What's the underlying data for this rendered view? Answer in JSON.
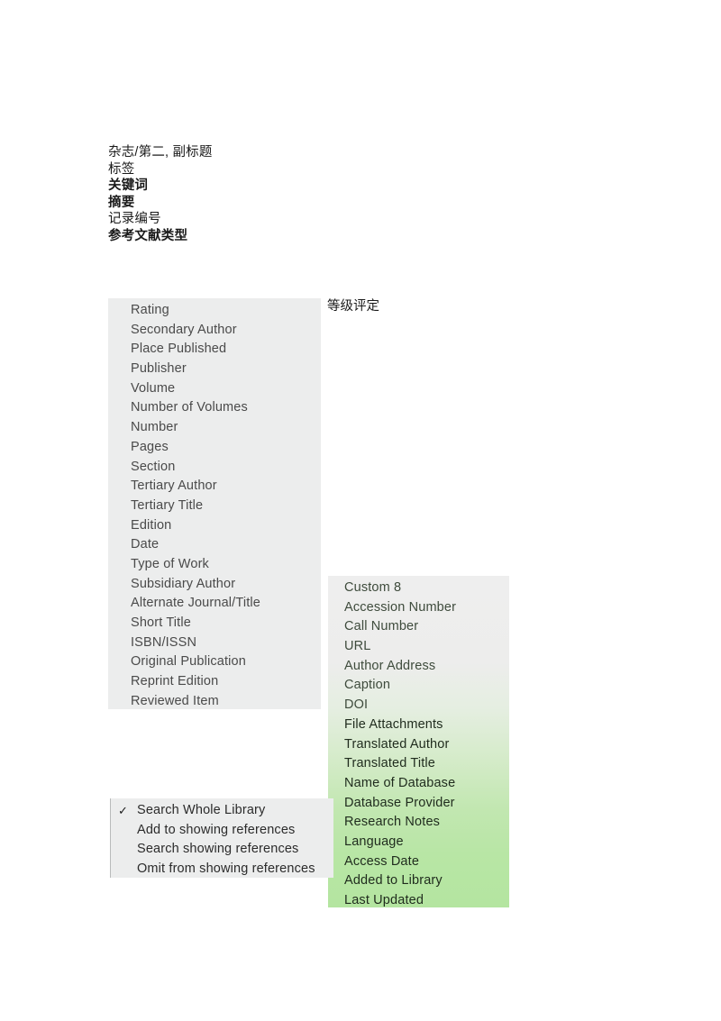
{
  "field_labels": {
    "rows": [
      {
        "text": "杂志/第二, 副标题",
        "bold": false
      },
      {
        "text": "标签",
        "bold": false
      },
      {
        "text": "关键词",
        "bold": true
      },
      {
        "text": "摘要",
        "bold": true
      },
      {
        "text": "记录编号",
        "bold": false
      },
      {
        "text": "参考文献类型",
        "bold": true
      }
    ]
  },
  "annotation": {
    "rating_label": "等级评定"
  },
  "field_list_panel": {
    "items": [
      "Rating",
      "Secondary Author",
      "Place Published",
      "Publisher",
      "Volume",
      "Number of Volumes",
      "Number",
      "Pages",
      "Section",
      "Tertiary Author",
      "Tertiary Title",
      "Edition",
      "Date",
      "Type of Work",
      "Subsidiary Author",
      "Alternate Journal/Title",
      "Short Title",
      "ISBN/ISSN",
      "Original Publication",
      "Reprint Edition",
      "Reviewed Item"
    ]
  },
  "extended_field_list_panel": {
    "items": [
      "Custom 8",
      "Accession Number",
      "Call Number",
      "URL",
      "Author Address",
      "Caption",
      "DOI",
      "File Attachments",
      "Translated Author",
      "Translated Title",
      "Name of Database",
      "Database Provider",
      "Research Notes",
      "Language",
      "Access Date",
      "Added to Library",
      "Last Updated"
    ],
    "gradient_start_color": "#eeeeee",
    "gradient_end_color": "#b4e5a0"
  },
  "search_scope_menu": {
    "checked_glyph": "✓",
    "items": [
      {
        "label": "Search Whole Library",
        "checked": true
      },
      {
        "label": "Add to showing references",
        "checked": false
      },
      {
        "label": "Search showing references",
        "checked": false
      },
      {
        "label": "Omit from showing references",
        "checked": false
      }
    ]
  }
}
